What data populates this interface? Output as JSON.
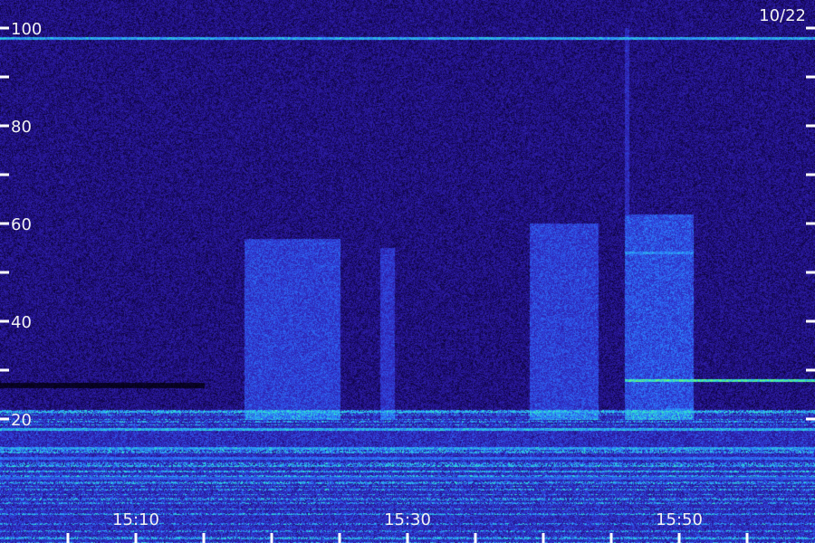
{
  "chart_data": {
    "type": "heatmap",
    "date_label": "10/22",
    "y_axis": {
      "range": [
        0,
        100
      ],
      "major_ticks": [
        20,
        40,
        60,
        80,
        100
      ],
      "minor_ticks": [
        30,
        50,
        70,
        90
      ],
      "tick_labels": [
        "20",
        "40",
        "60",
        "80",
        "100"
      ]
    },
    "x_axis": {
      "time_start": "15:00",
      "time_end": "15:60",
      "tick_labels": [
        {
          "t": "15:10",
          "label": "15:10"
        },
        {
          "t": "15:30",
          "label": "15:30"
        },
        {
          "t": "15:50",
          "label": "15:50"
        }
      ],
      "tick_marks": [
        "15:05",
        "15:10",
        "15:15",
        "15:20",
        "15:25",
        "15:30",
        "15:35",
        "15:40",
        "15:45",
        "15:50",
        "15:55"
      ]
    },
    "colormap": [
      "#000000",
      "#1a0a6e",
      "#2e1ea8",
      "#2f45e0",
      "#2b8cff",
      "#2ee6d0",
      "#7dff5a"
    ],
    "features": {
      "horizontal_lines": [
        {
          "freq": 98,
          "start": "15:00",
          "end": "15:60",
          "intensity": 0.78
        },
        {
          "freq": 28,
          "start": "15:46",
          "end": "15:60",
          "intensity": 0.95
        },
        {
          "freq": 54,
          "start": "15:46",
          "end": "15:51",
          "intensity": 0.72
        },
        {
          "freq": 22,
          "start": "15:49",
          "end": "15:51",
          "intensity": 0.7
        },
        {
          "freq": 18,
          "start": "15:00",
          "end": "15:60",
          "intensity": 0.8
        },
        {
          "freq": 14,
          "start": "15:00",
          "end": "15:60",
          "intensity": 0.7
        },
        {
          "freq": 12,
          "start": "15:00",
          "end": "15:60",
          "intensity": 0.65
        },
        {
          "freq": 8,
          "start": "15:00",
          "end": "15:60",
          "intensity": 0.6
        }
      ],
      "vertical_bands": [
        {
          "start": "15:18",
          "end": "15:25",
          "freq_min": 20,
          "freq_max": 57,
          "intensity": 0.55
        },
        {
          "start": "15:28",
          "end": "15:29",
          "freq_min": 20,
          "freq_max": 55,
          "intensity": 0.5
        },
        {
          "start": "15:39",
          "end": "15:44",
          "freq_min": 20,
          "freq_max": 60,
          "intensity": 0.55
        },
        {
          "start": "15:46",
          "end": "15:51",
          "freq_min": 20,
          "freq_max": 62,
          "intensity": 0.6
        },
        {
          "start": "15:46",
          "end": "15:46",
          "freq_min": 20,
          "freq_max": 100,
          "intensity": 0.45
        }
      ],
      "dark_band": {
        "freq": 27,
        "start": "15:00",
        "end": "15:15"
      },
      "low_freq_noise_below": 22
    }
  }
}
